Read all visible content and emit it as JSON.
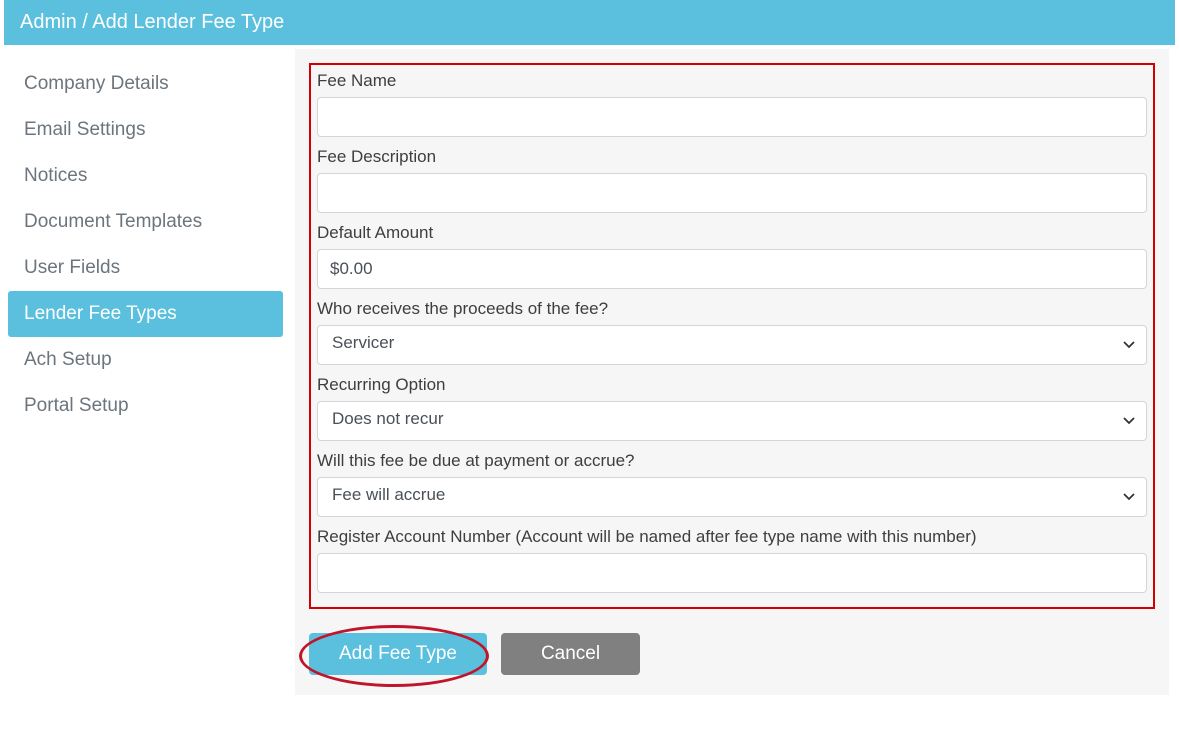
{
  "header": {
    "breadcrumb": "Admin / Add Lender Fee Type"
  },
  "sidebar": {
    "items": [
      {
        "label": "Company Details"
      },
      {
        "label": "Email Settings"
      },
      {
        "label": "Notices"
      },
      {
        "label": "Document Templates"
      },
      {
        "label": "User Fields"
      },
      {
        "label": "Lender Fee Types"
      },
      {
        "label": "Ach Setup"
      },
      {
        "label": "Portal Setup"
      }
    ],
    "active_index": 5
  },
  "form": {
    "fee_name": {
      "label": "Fee Name",
      "value": ""
    },
    "fee_description": {
      "label": "Fee Description",
      "value": ""
    },
    "default_amount": {
      "label": "Default Amount",
      "value": "$0.00"
    },
    "proceeds": {
      "label": "Who receives the proceeds of the fee?",
      "value": "Servicer"
    },
    "recurring": {
      "label": "Recurring Option",
      "value": "Does not recur"
    },
    "due": {
      "label": "Will this fee be due at payment or accrue?",
      "value": "Fee will accrue"
    },
    "register": {
      "label": "Register Account Number (Account will be named after fee type name with this number)",
      "value": ""
    }
  },
  "buttons": {
    "add": "Add Fee Type",
    "cancel": "Cancel"
  }
}
